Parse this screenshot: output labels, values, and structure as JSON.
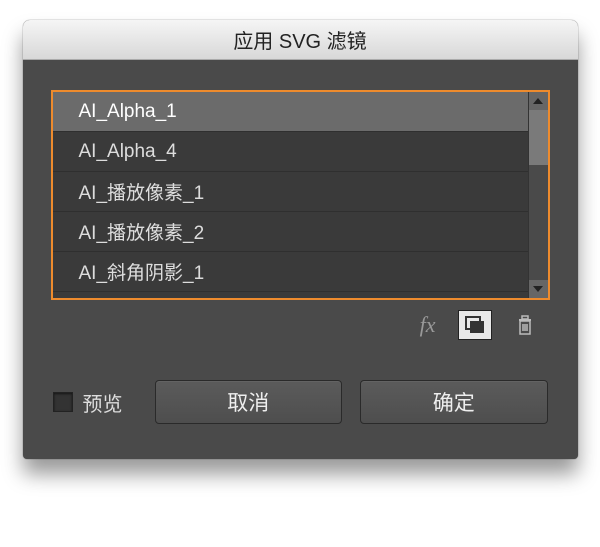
{
  "dialog": {
    "title": "应用 SVG 滤镜"
  },
  "filters": {
    "items": [
      {
        "label": "AI_Alpha_1",
        "selected": true
      },
      {
        "label": "AI_Alpha_4",
        "selected": false
      },
      {
        "label": "AI_播放像素_1",
        "selected": false
      },
      {
        "label": "AI_播放像素_2",
        "selected": false
      },
      {
        "label": "AI_斜角阴影_1",
        "selected": false
      }
    ]
  },
  "toolbar": {
    "fx_label": "fx"
  },
  "footer": {
    "preview_label": "预览",
    "cancel_label": "取消",
    "ok_label": "确定"
  }
}
